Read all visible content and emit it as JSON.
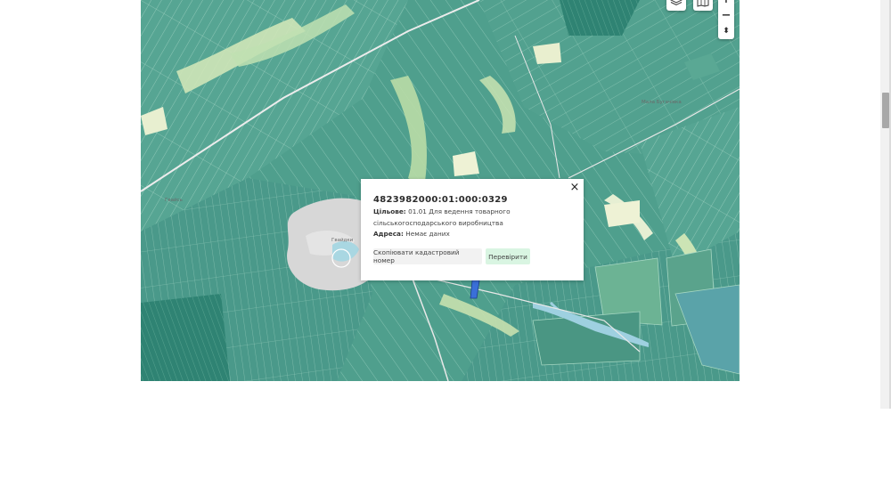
{
  "map": {
    "place_labels": [
      {
        "text": "Мала Бугачівка"
      },
      {
        "text": "Гвайсь"
      },
      {
        "text": "Гвайдки"
      }
    ]
  },
  "controls": {
    "layers_icon": "layers-icon",
    "map_icon": "map-icon",
    "zoom_in": "+",
    "zoom_out": "−",
    "reset_north": "⬍"
  },
  "popup": {
    "cadastral_number": "4823982000:01:000:0329",
    "purpose_label": "Цільове:",
    "purpose_value": "01.01 Для ведення товарного сільськогосподарського виробництва",
    "address_label": "Адреса:",
    "address_value": "Немає даних",
    "copy_button": "Скопіювати кадастровий номер",
    "check_button": "Перевірити",
    "close_symbol": "×"
  },
  "colors": {
    "parcel_fill": "#4f9f8d",
    "parcel_stroke": "#9fd0c0",
    "village": "#d7d7d7",
    "meadow": "#dbe9c1",
    "water": "#9ed0e0",
    "highlight": "#3a6fd8",
    "check_button_bg": "#d9f5e2"
  }
}
